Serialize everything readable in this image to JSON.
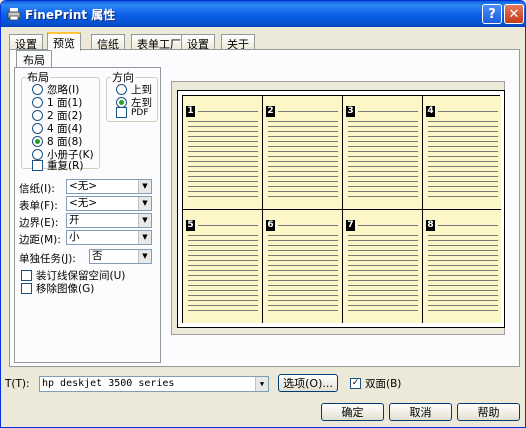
{
  "window": {
    "title": "FinePrint 属性"
  },
  "tabs": [
    "设置",
    "预览",
    "信纸",
    "表单工厂",
    "设置",
    "关于"
  ],
  "subtab": "布局",
  "layout_group": {
    "legend": "布局",
    "options": [
      "忽略(I)",
      "1 面(1)",
      "2 面(2)",
      "4 面(4)",
      "8 面(8)",
      "小册子(K)"
    ],
    "selected_index": 4,
    "duplex_label": "重复(R)"
  },
  "orientation_group": {
    "legend": "方向",
    "options": [
      "上到",
      "左到"
    ],
    "selected_index": 1,
    "pdf_label": "PDF"
  },
  "fields": [
    {
      "label": "信纸(I):",
      "value": "<无>"
    },
    {
      "label": "表单(F):",
      "value": "<无>"
    },
    {
      "label": "边界(E):",
      "value": "开"
    },
    {
      "label": "边距(M):",
      "value": "小"
    }
  ],
  "single_job": {
    "label": "单独任务(J):",
    "value": "否"
  },
  "checkboxes": [
    {
      "label": "装订线保留空间(U)",
      "checked": false
    },
    {
      "label": "移除图像(G)",
      "checked": false
    }
  ],
  "preview": {
    "pages": [
      "1",
      "2",
      "3",
      "4",
      "5",
      "6",
      "7",
      "8"
    ]
  },
  "printer": {
    "label": "T(T):",
    "value": "hp deskjet 3500 series"
  },
  "options_button": "选项(O)...",
  "duplex": {
    "label": "双面(B)",
    "checked": true
  },
  "buttons": {
    "ok": "确定",
    "cancel": "取消",
    "help": "帮助"
  },
  "title_buttons": {
    "help": "?",
    "close": "✕"
  },
  "colors": {
    "titlebar": "#0a5ee6",
    "page_fill": "#fdf6c6",
    "dialog_bg": "#ece9d8"
  }
}
